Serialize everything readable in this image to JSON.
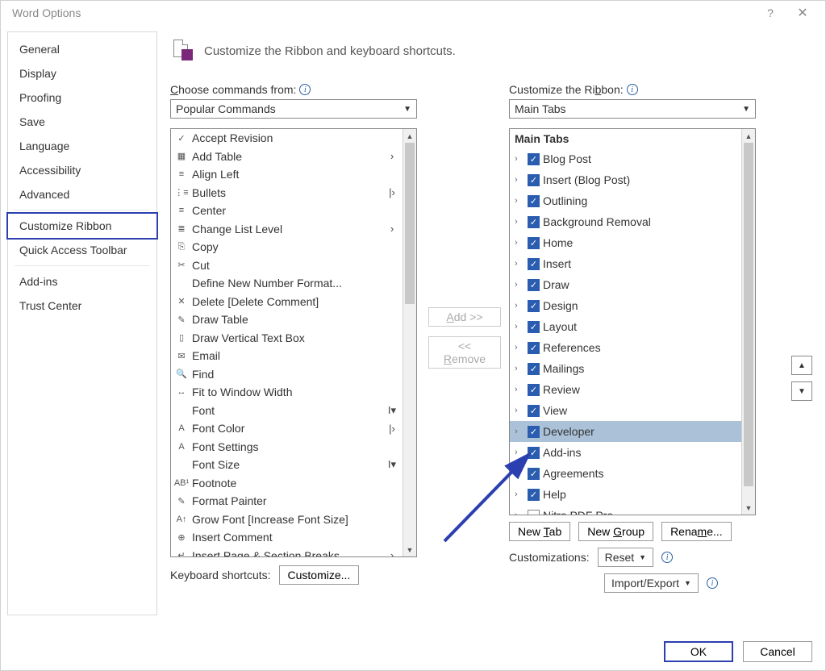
{
  "titlebar": {
    "title": "Word Options"
  },
  "sidebar": {
    "items": [
      "General",
      "Display",
      "Proofing",
      "Save",
      "Language",
      "Accessibility",
      "Advanced",
      "Customize Ribbon",
      "Quick Access Toolbar",
      "Add-ins",
      "Trust Center"
    ],
    "selected": "Customize Ribbon"
  },
  "heading": "Customize the Ribbon and keyboard shortcuts.",
  "choose_label_pre": "C",
  "choose_label_rest": "hoose commands from:",
  "choose_value": "Popular Commands",
  "customize_label_pre": "Customize the Ri",
  "customize_label_u": "b",
  "customize_label_post": "bon:",
  "customize_value": "Main Tabs",
  "commands": [
    {
      "icon": "✓",
      "text": "Accept Revision",
      "tail": ""
    },
    {
      "icon": "▦",
      "text": "Add Table",
      "tail": "›"
    },
    {
      "icon": "≡",
      "text": "Align Left",
      "tail": ""
    },
    {
      "icon": "⋮≡",
      "text": "Bullets",
      "tail": "|›"
    },
    {
      "icon": "≡",
      "text": "Center",
      "tail": ""
    },
    {
      "icon": "≣",
      "text": "Change List Level",
      "tail": "›"
    },
    {
      "icon": "⎘",
      "text": "Copy",
      "tail": ""
    },
    {
      "icon": "✂",
      "text": "Cut",
      "tail": ""
    },
    {
      "icon": "",
      "text": "Define New Number Format...",
      "tail": ""
    },
    {
      "icon": "✕",
      "text": "Delete [Delete Comment]",
      "tail": ""
    },
    {
      "icon": "✎",
      "text": "Draw Table",
      "tail": ""
    },
    {
      "icon": "▯",
      "text": "Draw Vertical Text Box",
      "tail": ""
    },
    {
      "icon": "✉",
      "text": "Email",
      "tail": ""
    },
    {
      "icon": "🔍",
      "text": "Find",
      "tail": ""
    },
    {
      "icon": "↔",
      "text": "Fit to Window Width",
      "tail": ""
    },
    {
      "icon": "",
      "text": "Font",
      "tail": "I▾"
    },
    {
      "icon": "A",
      "text": "Font Color",
      "tail": "|›"
    },
    {
      "icon": "A",
      "text": "Font Settings",
      "tail": ""
    },
    {
      "icon": "",
      "text": "Font Size",
      "tail": "I▾"
    },
    {
      "icon": "AB¹",
      "text": "Footnote",
      "tail": ""
    },
    {
      "icon": "✎",
      "text": "Format Painter",
      "tail": ""
    },
    {
      "icon": "A↑",
      "text": "Grow Font [Increase Font Size]",
      "tail": ""
    },
    {
      "icon": "⊕",
      "text": "Insert Comment",
      "tail": ""
    },
    {
      "icon": "↵",
      "text": "Insert Page & Section Breaks",
      "tail": "›"
    }
  ],
  "kb_label": "Keyboard shortcuts:",
  "kb_btn": "Customize...",
  "add_btn": "Add >>",
  "remove_btn": "<< Remove",
  "tree_head": "Main Tabs",
  "tree_items": [
    {
      "label": "Blog Post",
      "checked": true
    },
    {
      "label": "Insert (Blog Post)",
      "checked": true
    },
    {
      "label": "Outlining",
      "checked": true
    },
    {
      "label": "Background Removal",
      "checked": true
    },
    {
      "label": "Home",
      "checked": true
    },
    {
      "label": "Insert",
      "checked": true
    },
    {
      "label": "Draw",
      "checked": true
    },
    {
      "label": "Design",
      "checked": true
    },
    {
      "label": "Layout",
      "checked": true
    },
    {
      "label": "References",
      "checked": true
    },
    {
      "label": "Mailings",
      "checked": true
    },
    {
      "label": "Review",
      "checked": true
    },
    {
      "label": "View",
      "checked": true
    },
    {
      "label": "Developer",
      "checked": true,
      "selected": true
    },
    {
      "label": "Add-ins",
      "checked": true
    },
    {
      "label": "Agreements",
      "checked": true
    },
    {
      "label": "Help",
      "checked": true
    },
    {
      "label": "Nitro PDF Pro",
      "checked": false
    }
  ],
  "new_tab": "New Tab",
  "new_group": "New Group",
  "rename": "Rename...",
  "cust_label": "Customizations:",
  "reset": "Reset",
  "import_export": "Import/Export",
  "ok": "OK",
  "cancel": "Cancel",
  "underline": {
    "new_tab_u": "T",
    "new_tab_pre": "New ",
    "new_tab_post": "ab",
    "new_group_u": "G",
    "new_group_pre": "New ",
    "new_group_post": "roup",
    "rename_u": "m",
    "rename_pre": "Rena",
    "rename_post": "e...",
    "remove_u": "R",
    "remove_pre": "<< ",
    "remove_post": "emove",
    "add_u": "A",
    "add_pre": "",
    "add_post": "dd >>"
  }
}
